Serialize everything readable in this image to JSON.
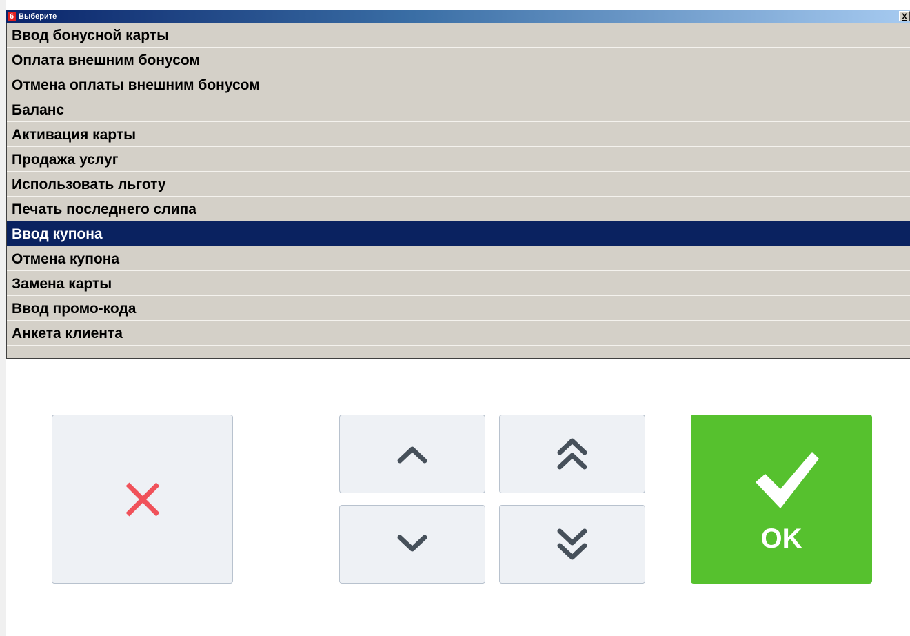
{
  "window": {
    "badge": "6",
    "title": "Выберите",
    "close_label": "X"
  },
  "list": {
    "items": [
      {
        "label": "Ввод бонусной карты",
        "selected": false
      },
      {
        "label": "Оплата внешним бонусом",
        "selected": false
      },
      {
        "label": "Отмена оплаты внешним бонусом",
        "selected": false
      },
      {
        "label": "Баланс",
        "selected": false
      },
      {
        "label": "Активация карты",
        "selected": false
      },
      {
        "label": "Продажа услуг",
        "selected": false
      },
      {
        "label": "Использовать льготу",
        "selected": false
      },
      {
        "label": "Печать последнего слипа",
        "selected": false
      },
      {
        "label": "Ввод купона",
        "selected": true
      },
      {
        "label": "Отмена купона",
        "selected": false
      },
      {
        "label": "Замена карты",
        "selected": false
      },
      {
        "label": "Ввод промо-кода",
        "selected": false
      },
      {
        "label": "Анкета клиента",
        "selected": false
      }
    ]
  },
  "buttons": {
    "cancel_icon": "close-icon",
    "up_icon": "chevron-up-icon",
    "page_up_icon": "double-chevron-up-icon",
    "down_icon": "chevron-down-icon",
    "page_down_icon": "double-chevron-down-icon",
    "ok_icon": "checkmark-icon",
    "ok_label": "OK"
  },
  "colors": {
    "selection": "#0a2260",
    "list_background": "#d4d0c8",
    "ok_green": "#56c12e",
    "cancel_red": "#f0525a",
    "arrow_gray": "#46505a"
  }
}
